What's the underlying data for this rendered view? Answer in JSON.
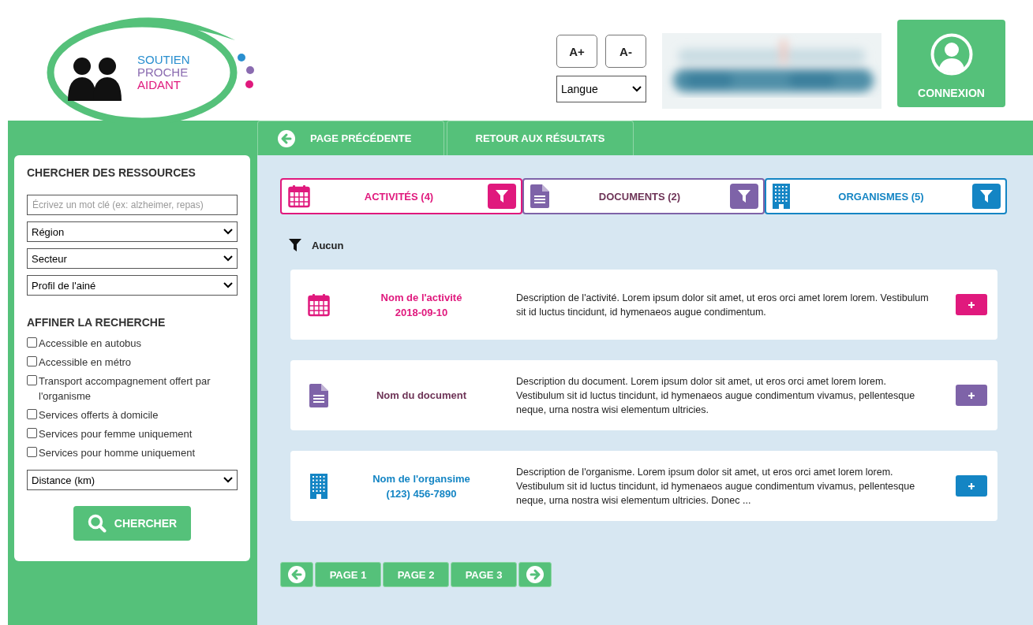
{
  "logo": {
    "lines": [
      {
        "text": "SOUTIEN",
        "color": "#2a8fcf"
      },
      {
        "text": "PROCHE",
        "color": "#8a6bb0"
      },
      {
        "text": "AIDANT",
        "color": "#e0197d"
      }
    ]
  },
  "header": {
    "font_buttons": [
      "A+",
      "A-"
    ],
    "language": {
      "value": "Langue"
    },
    "login": {
      "label": "CONNEXION"
    }
  },
  "nav": {
    "back": "PAGE PRÉCÉDENTE",
    "results": "RETOUR AUX RÉSULTATS"
  },
  "sidebar": {
    "title": "CHERCHER DES RESSOURCES",
    "search": {
      "placeholder": "Écrivez un mot clé (ex: alzheimer, repas)"
    },
    "selects": [
      "Région",
      "Secteur",
      "Profil de l'ainé"
    ],
    "refine_title": "AFFINER LA RECHERCHE",
    "options": [
      {
        "label": "Accessible en autobus",
        "checked": false
      },
      {
        "label": "Accessible en métro",
        "checked": false
      },
      {
        "label": "Transport accompagnement offert par l'organisme",
        "checked": false
      },
      {
        "label": "Services offerts à domicile",
        "checked": false
      },
      {
        "label": "Services pour femme uniquement",
        "checked": false
      },
      {
        "label": "Services pour homme uniquement",
        "checked": false
      }
    ],
    "distance": "Distance (km)",
    "submit": "CHERCHER"
  },
  "categories": [
    {
      "kind": "calendar",
      "label": "ACTIVITÉS (4)",
      "color": "#e0197d"
    },
    {
      "kind": "document",
      "label": "DOCUMENTS (2)",
      "color": "#7e63a8"
    },
    {
      "kind": "building",
      "label": "ORGANISMES (5)",
      "color": "#1485c4"
    }
  ],
  "active_filter": "Aucun",
  "results": [
    {
      "kind": "calendar",
      "color": "#e0197d",
      "title": [
        "Nom de l'activité",
        "2018-09-10"
      ],
      "description": "Description de l'activité. Lorem ipsum dolor sit amet, ut eros orci amet lorem lorem. Vestibulum sit id luctus tincidunt, id hymenaeos augue condimentum."
    },
    {
      "kind": "document",
      "color": "#7e63a8",
      "title": [
        "Nom du document"
      ],
      "description": "Description du document. Lorem ipsum dolor sit amet, ut eros orci amet lorem lorem. Vestibulum sit id luctus tincidunt, id hymenaeos augue condimentum vivamus, pellentesque neque, urna nostra wisi elementum ultricies."
    },
    {
      "kind": "building",
      "color": "#1485c4",
      "title": [
        "Nom de l'organsime",
        "(123)  456-7890"
      ],
      "description": "Description de l'organisme.  Lorem ipsum dolor sit amet, ut eros orci amet lorem lorem. Vestibulum sit id luctus tincidunt, id hymenaeos augue condimentum vivamus, pellentesque neque, urna nostra wisi elementum ultricies. Donec ..."
    }
  ],
  "pagination": {
    "pages": [
      "PAGE 1",
      "PAGE 2",
      "PAGE 3"
    ]
  }
}
